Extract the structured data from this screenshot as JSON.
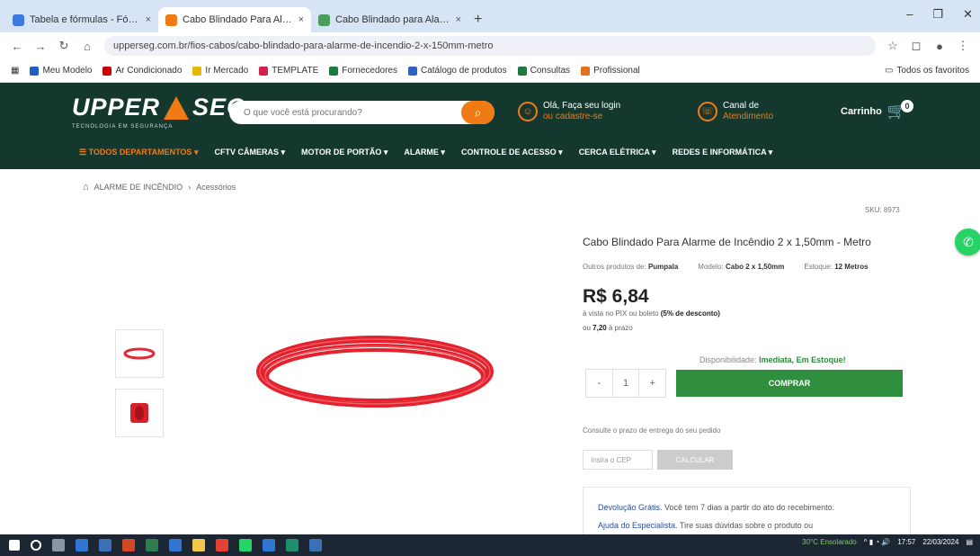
{
  "browser": {
    "tabs": [
      {
        "label": "Tabela e fórmulas - Fórmulas",
        "close": "×"
      },
      {
        "label": "Cabo Blindado Para Alarme de Incêndio",
        "close": "×"
      },
      {
        "label": "Cabo Blindado para Alarme",
        "close": "×"
      }
    ],
    "new_tab": "+",
    "window_controls": [
      "–",
      "❐",
      "✕"
    ],
    "url": "upperseg.com.br/fios-cabos/cabo-blindado-para-alarme-de-incendio-2-x-150mm-metro",
    "bookmarks": [
      "Meu Modelo",
      "Ar Condicionado",
      "Ir Mercado",
      "TEMPLATE",
      "Fornecedores",
      "Catálogo de produtos",
      "Consultas",
      "Profissional"
    ],
    "bookmarks_right": "Todos os favoritos"
  },
  "site": {
    "logo_left": "UPPER",
    "logo_right": "SEG",
    "logo_tagline": "TECNOLOGIA EM SEGURANÇA",
    "search_placeholder": "O que você está procurando?",
    "search_icon": "search-icon",
    "account": {
      "line1": "Olá, Faça seu login",
      "line2": "ou cadastre-se"
    },
    "channel": {
      "line1": "Canal de",
      "line2": "Atendimento"
    },
    "cart": {
      "label": "Carrinho",
      "count": "0"
    },
    "menu": [
      "TODOS DEPARTAMENTOS",
      "CFTV CÂMERAS",
      "MOTOR DE PORTÃO",
      "ALARME",
      "CONTROLE DE ACESSO",
      "CERCA ELÉTRICA",
      "REDES E INFORMÁTICA"
    ],
    "menu_caret": "▾"
  },
  "breadcrumb": {
    "home_icon": "home-icon",
    "items": [
      "ALARME DE INCÊNDIO",
      "Acessórios"
    ],
    "separator": "›"
  },
  "product": {
    "sku": "SKU: 8973",
    "title": "Cabo Blindado Para Alarme de Incêndio 2 x 1,50mm - Metro",
    "brand_label": "Outros produtos de:",
    "brand_value": "Pumpala",
    "model_label": "Modelo:",
    "model_value": "Cabo 2 x 1,50mm",
    "unit_label": "Estoque:",
    "unit_value": "12 Metros",
    "price": "R$ 6,84",
    "pix_text": "à vista no PIX ou boleto",
    "pix_discount": "(5% de desconto)",
    "installment_prefix": "ou",
    "installment_value": "7,20",
    "installment_suffix": "à prazo",
    "availability_label": "Disponibilidade:",
    "availability_value": "Imediata, Em Estoque!",
    "qty_minus": "-",
    "qty_value": "1",
    "qty_plus": "+",
    "buy_label": "COMPRAR",
    "shipping_label": "Consulte o prazo de entrega do seu pedido",
    "cep_placeholder": "Insira o CEP",
    "calc_label": "CALCULAR",
    "info_line1_bold": "Devolução Grátis.",
    "info_line1": "Você tem 7 dias a partir do ato do recebimento.",
    "info_line2_bold": "Ajuda do Especialista.",
    "info_line2": "Tire suas dúvidas sobre o produto ou"
  },
  "whatsapp_icon": "whatsapp-icon",
  "taskbar": {
    "weather": "30°C Ensolarado",
    "time": "17:57",
    "date": "22/03/2024"
  },
  "colors": {
    "header": "#14382e",
    "accent": "#f07a13",
    "buy": "#2f8f3e",
    "whatsapp": "#25d366"
  }
}
